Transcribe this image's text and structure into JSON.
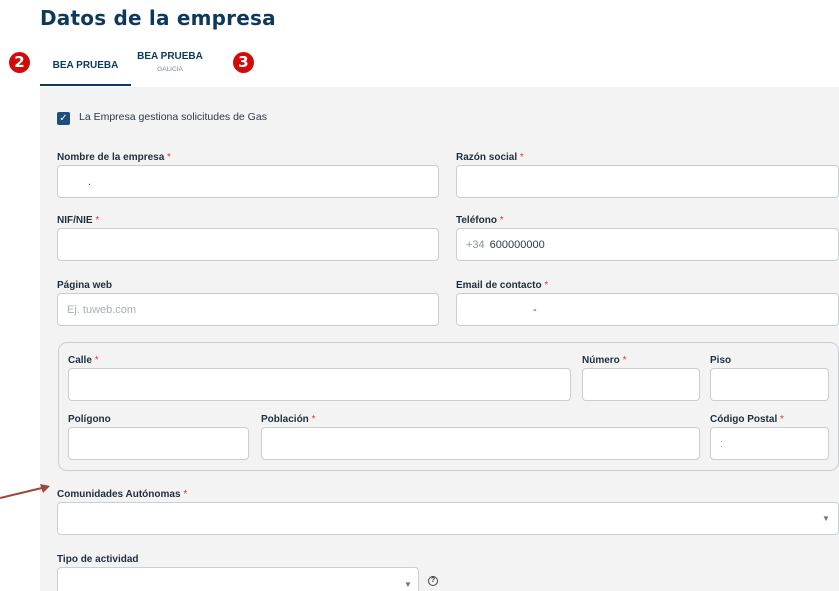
{
  "page": {
    "title": "Datos de la empresa"
  },
  "tabs": [
    {
      "label": "BEA PRUEBA",
      "sublabel": "",
      "active": true
    },
    {
      "label": "BEA PRUEBA",
      "sublabel": "GALICIA",
      "active": false
    }
  ],
  "badges": [
    "2",
    "3"
  ],
  "gas_checkbox": {
    "checked": true,
    "label": "La Empresa gestiona solicitudes de Gas"
  },
  "form": {
    "company_name": {
      "label": "Nombre de la empresa",
      "value": "."
    },
    "business_name": {
      "label": "Razón social",
      "value": ""
    },
    "nif": {
      "label": "NIF/NIE",
      "value": ""
    },
    "phone": {
      "label": "Teléfono",
      "prefix": "+34",
      "value": "600000000"
    },
    "website": {
      "label": "Página web",
      "placeholder": "Ej. tuweb.com",
      "value": ""
    },
    "email": {
      "label": "Email de contacto",
      "value": "-"
    },
    "street": {
      "label": "Calle",
      "value": ""
    },
    "number": {
      "label": "Número",
      "value": ""
    },
    "floor": {
      "label": "Piso",
      "value": ""
    },
    "polygon": {
      "label": "Polígono",
      "value": ""
    },
    "town": {
      "label": "Población",
      "value": ""
    },
    "postal_code": {
      "label": "Código Postal",
      "value": ":"
    },
    "region": {
      "label": "Comunidades Autónomas",
      "value": ""
    },
    "activity": {
      "label": "Tipo de actividad",
      "value": ""
    }
  },
  "required_marker": "*",
  "icons": {
    "dropdown": "chevron-down",
    "help": "question-circle",
    "check": "checkmark"
  },
  "colors": {
    "accent": "#0d3a5c",
    "badge": "#d10a0a",
    "arrow": "#a0453a",
    "required": "#d43b3b"
  }
}
